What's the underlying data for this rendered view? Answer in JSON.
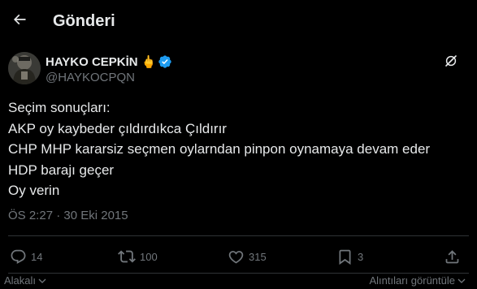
{
  "header": {
    "title": "Gönderi",
    "back_icon": "arrow-left-icon"
  },
  "author": {
    "display_name": "HAYKO CEPKİN",
    "name_emoji": "🖕",
    "handle": "@HAYKOCPQN",
    "verified": true,
    "verified_color": "#1d9bf0",
    "grok_icon": "grok-icon"
  },
  "tweet": {
    "lines": [
      "Seçim sonuçları:",
      "AKP oy kaybeder çıldırdıkca Çıldırır",
      "CHP MHP kararsiz seçmen oylarndan pinpon oynamaya devam eder",
      "HDP barajı geçer",
      "Oy verin"
    ],
    "timestamp": "ÖS 2:27 · 30 Eki 2015"
  },
  "actions": {
    "replies": "14",
    "reposts": "100",
    "likes": "315",
    "bookmarks": "3",
    "reply_icon": "reply-icon",
    "repost_icon": "repost-icon",
    "like_icon": "heart-icon",
    "bookmark_icon": "bookmark-icon",
    "share_icon": "share-icon"
  },
  "footer": {
    "left_label": "Alakalı",
    "right_label": "Alıntıları görüntüle"
  },
  "colors": {
    "background": "#000000",
    "text": "#e7e9ea",
    "muted": "#71767b",
    "border": "#2f3336",
    "accent": "#1d9bf0"
  }
}
